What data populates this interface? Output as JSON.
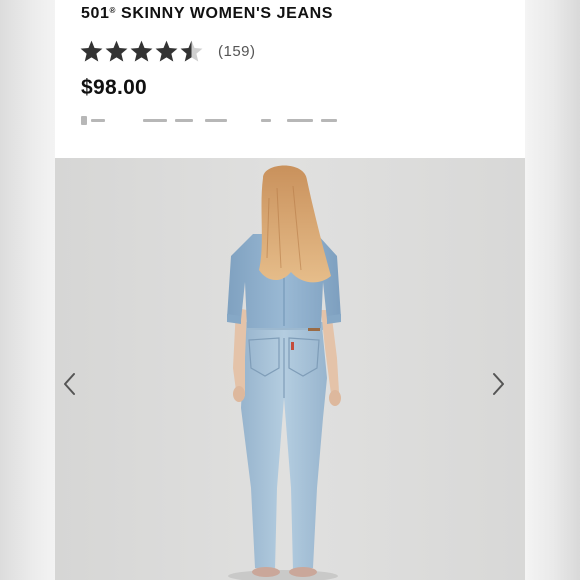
{
  "product": {
    "title": "501",
    "title_mark": "®",
    "title_rest": " SKINNY WOMEN'S JEANS",
    "rating_value": 4.5,
    "rating_max": 5,
    "review_count": "(159)",
    "price": "$98.00"
  },
  "gallery": {
    "prev_icon": "chevron-left-icon",
    "next_icon": "chevron-right-icon"
  },
  "colors": {
    "star_filled": "#333333",
    "star_empty": "#cfcfcf",
    "denim": "#a9c4da",
    "shirt": "#8fb0cd",
    "hair": "#d9a872",
    "backdrop": "#dddddc"
  }
}
